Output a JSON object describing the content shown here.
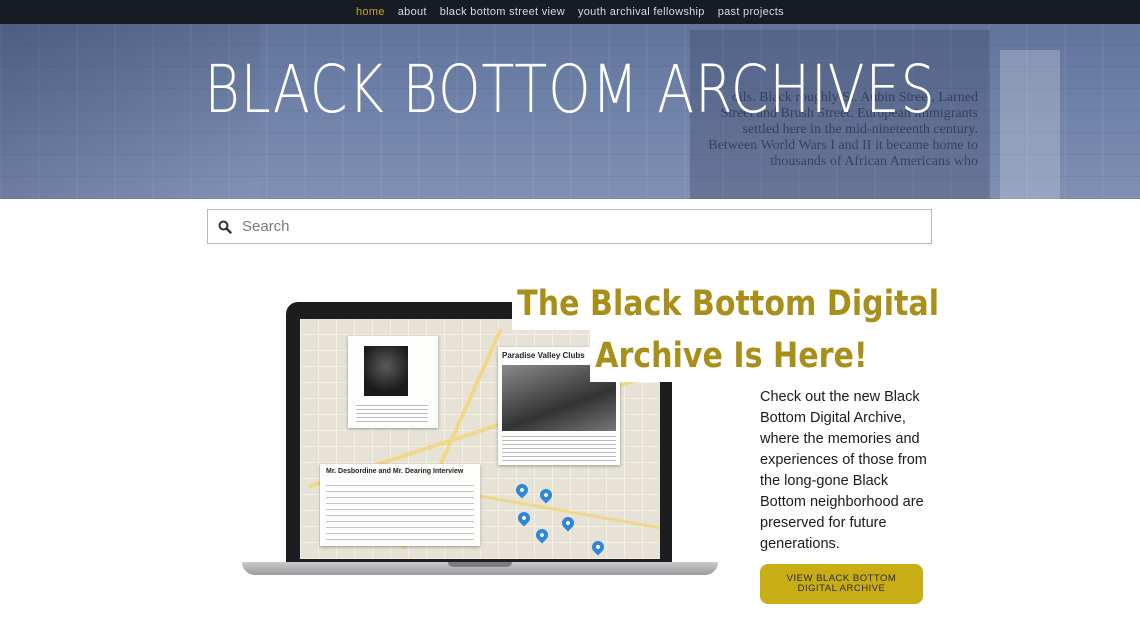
{
  "nav": {
    "items": [
      {
        "label": "home",
        "active": true
      },
      {
        "label": "about",
        "active": false
      },
      {
        "label": "black bottom street view",
        "active": false
      },
      {
        "label": "youth archival fellowship",
        "active": false
      },
      {
        "label": "past projects",
        "active": false
      }
    ]
  },
  "site_title": "BLACK BOTTOM ARCHIVES",
  "hero_plaque_text": "oils. Black roughly St. Aubin Street, Larned Street and Brush Street. European immigrants settled here in the mid-nineteenth century. Between World Wars I and II it became home to thousands of African Americans who",
  "search": {
    "icon": "search-icon",
    "placeholder": "Search",
    "value": ""
  },
  "feature": {
    "headline_line1": "The Black Bottom Digital",
    "headline_line2": "Archive Is Here!",
    "description": "Check out the new Black Bottom Digital Archive, where the memories and experiences of those from the long-gone Black Bottom neighborhood are preserved for future generations.",
    "cta_label": "VIEW BLACK BOTTOM DIGITAL ARCHIVE",
    "screen_card_titles": [
      "Paradise Valley Clubs",
      "Mr. Desbordine and Mr. Dearing Interview"
    ]
  },
  "colors": {
    "nav_bg": "#171b24",
    "nav_active": "#c6a62c",
    "headline": "#a88f1a",
    "cta_bg": "#c9ad17"
  }
}
